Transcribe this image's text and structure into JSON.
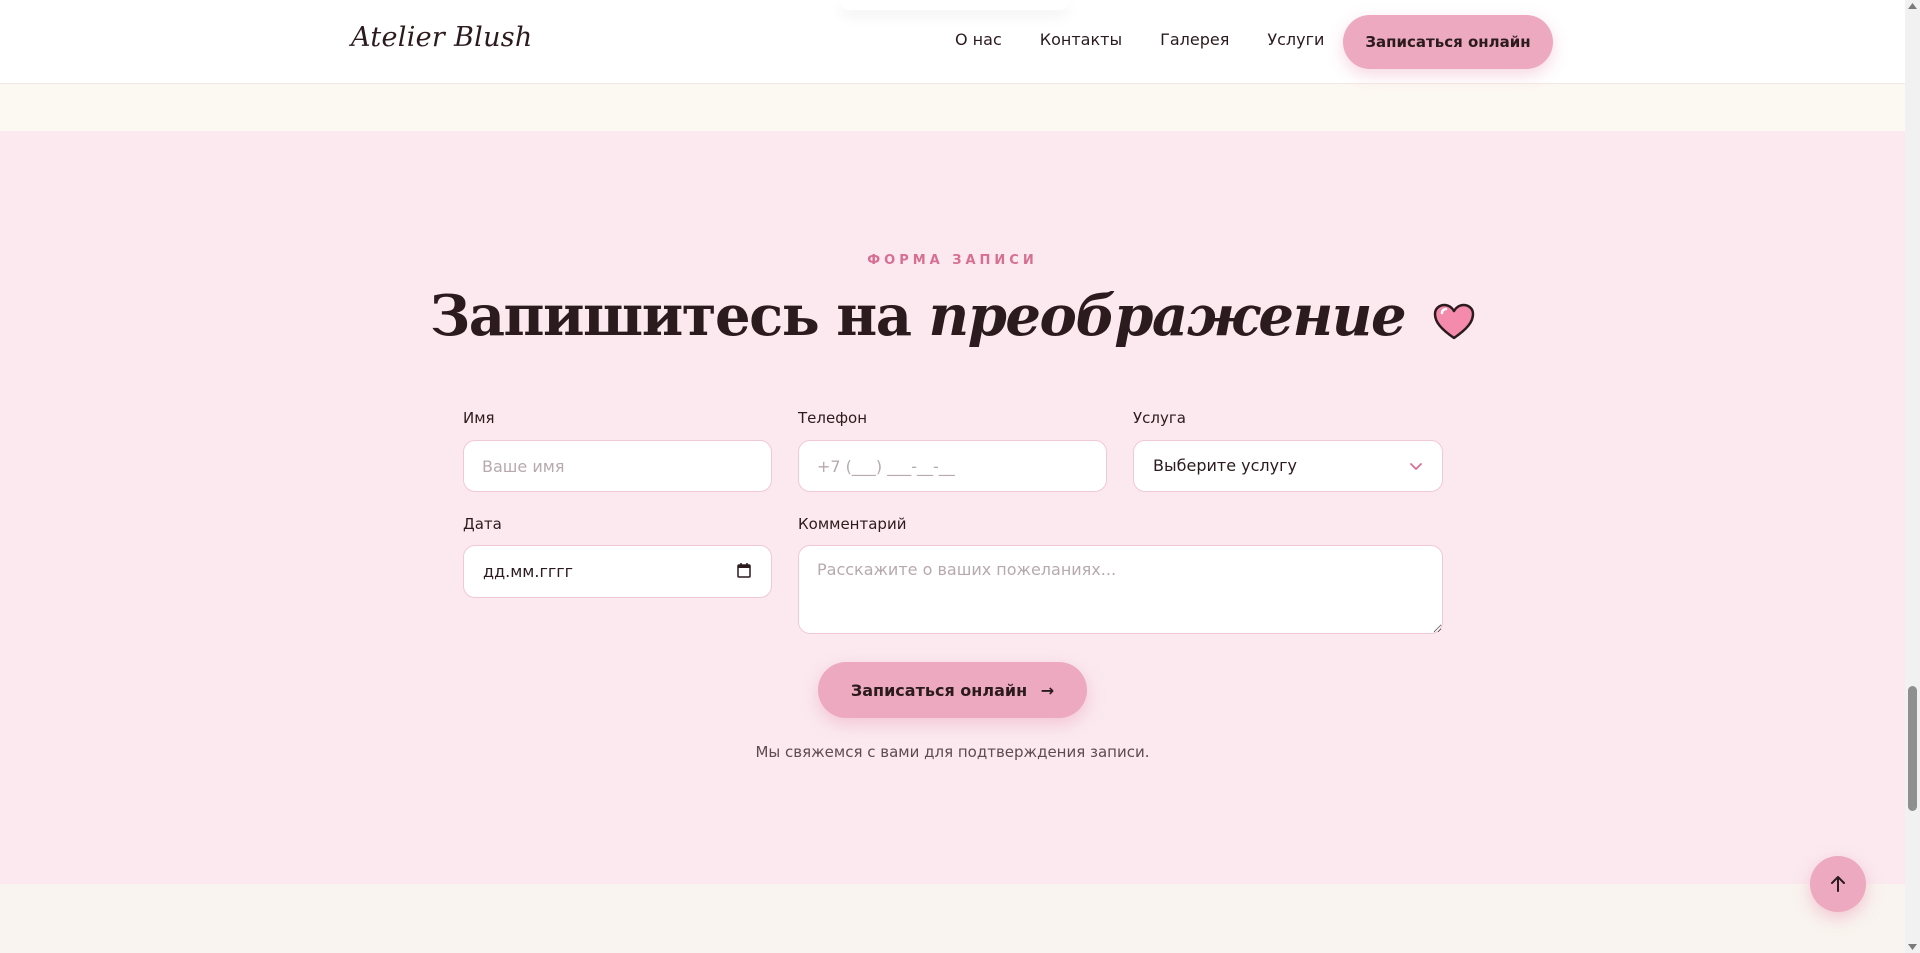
{
  "header": {
    "logo": "Atelier Blush",
    "nav": [
      "О нас",
      "Контакты",
      "Галерея",
      "Услуги"
    ],
    "cta_label": "Записаться онлайн"
  },
  "booking": {
    "eyebrow": "ФОРМА ЗАПИСИ",
    "title_plain": "Запишитесь на",
    "title_italic": "преображение",
    "title_icon": "heart-icon",
    "fields": {
      "name_label": "Имя",
      "name_placeholder": "Ваше имя",
      "phone_label": "Телефон",
      "phone_placeholder": "+7 (___) ___-__-__",
      "service_label": "Услуга",
      "service_value": "Выберите услугу",
      "date_label": "Дата",
      "date_value": "дд.мм.гггг",
      "comment_label": "Комментарий",
      "comment_placeholder": "Расскажите о ваших пожеланиях..."
    },
    "submit_label": "Записаться онлайн",
    "submit_arrow": "→",
    "note": "Мы свяжемся с вами для подтверждения записи."
  },
  "colors": {
    "accent": "#eca9bf",
    "section_bg": "#fbe9ef",
    "eyebrow": "#d76f93",
    "text": "#2b1a1e"
  }
}
